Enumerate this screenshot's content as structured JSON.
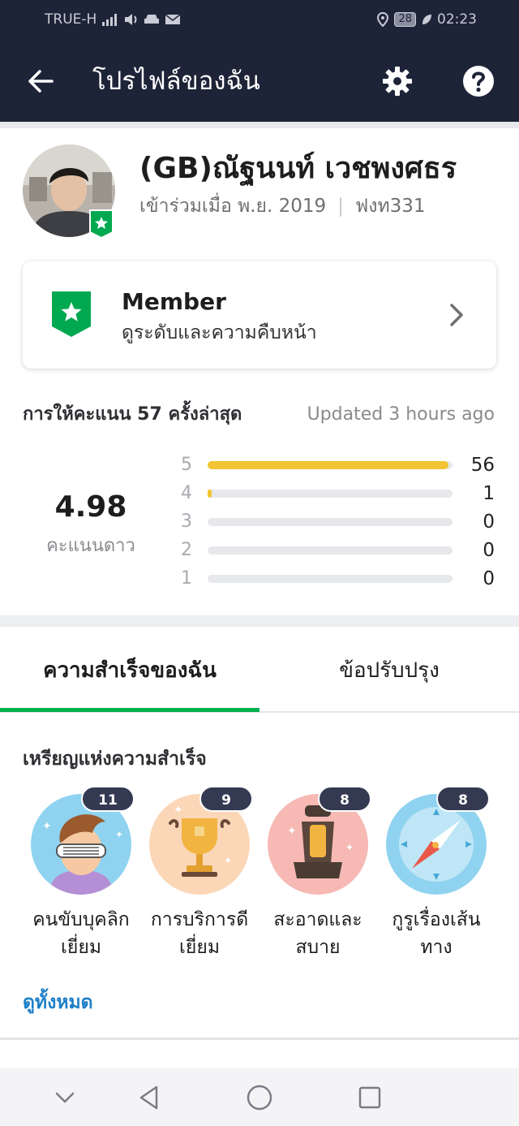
{
  "status_bar": {
    "carrier": "TRUE-H",
    "battery": "28",
    "time": "02:23"
  },
  "app_bar": {
    "title": "โปรไฟล์ของฉัน",
    "back_icon": "arrow-left",
    "settings_icon": "gear",
    "help_icon": "question-circle"
  },
  "profile": {
    "name": "(GB)ณัฐนนท์ เวชพงศธร",
    "joined": "เข้าร่วมเมื่อ พ.ย. 2019",
    "driver_id": "ฟงท331",
    "badge_icon": "star-shield"
  },
  "membership": {
    "tier": "Member",
    "subtitle": "ดูระดับและความคืบหน้า",
    "icon": "star-shield",
    "color": "#00a84f"
  },
  "ratings": {
    "heading": "การให้คะแนน 57 ครั้งล่าสุด",
    "updated": "Updated 3 hours ago",
    "score": "4.98",
    "score_label": "คะแนนดาว",
    "total": 57,
    "rows": [
      {
        "stars": "5",
        "count": "56",
        "fraction": 0.982
      },
      {
        "stars": "4",
        "count": "1",
        "fraction": 0.018
      },
      {
        "stars": "3",
        "count": "0",
        "fraction": 0
      },
      {
        "stars": "2",
        "count": "0",
        "fraction": 0
      },
      {
        "stars": "1",
        "count": "0",
        "fraction": 0
      }
    ],
    "bar_color": "#f3c433"
  },
  "tabs": [
    {
      "label": "ความสำเร็จของฉัน",
      "active": true
    },
    {
      "label": "ข้อปรับปรุง",
      "active": false
    }
  ],
  "medals": {
    "title": "เหรียญแห่งความสำเร็จ",
    "items": [
      {
        "count": "11",
        "label_line1": "คนขับบุคลิก",
        "label_line2": "เยี่ยม",
        "icon": "cool-driver"
      },
      {
        "count": "9",
        "label_line1": "การบริการดี",
        "label_line2": "เยี่ยม",
        "icon": "trophy"
      },
      {
        "count": "8",
        "label_line1": "สะอาดและ",
        "label_line2": "สบาย",
        "icon": "car-seat"
      },
      {
        "count": "8",
        "label_line1": "กูรูเรื่องเส้น",
        "label_line2": "ทาง",
        "icon": "compass"
      }
    ],
    "see_all": "ดูทั้งหมด"
  },
  "accent_color": "#00b14f",
  "link_color": "#1c7fc7",
  "nav_bar": {
    "icons": [
      "chevron-down",
      "back-triangle",
      "home-circle",
      "recents-square"
    ]
  }
}
